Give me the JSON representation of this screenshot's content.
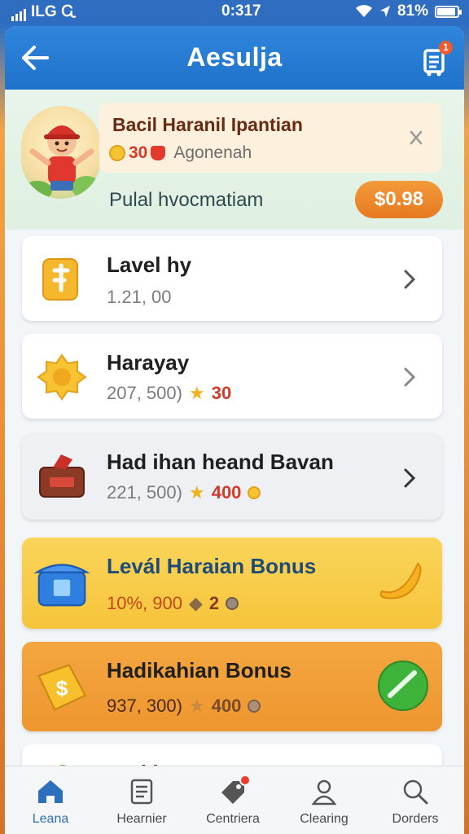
{
  "status_bar": {
    "carrier": "ILG",
    "time": "0:317",
    "battery": "81%"
  },
  "header": {
    "title": "Aesulja",
    "cart_badge": "1"
  },
  "hero": {
    "title": "Bacil Haranil Ipantian",
    "amount": "30",
    "subtitle": "Agonenah",
    "label": "Pulal hvocmatiam",
    "price": "$0.98"
  },
  "items": [
    {
      "title": "Lavel hy",
      "meta": "1.21, 00",
      "reward": "",
      "style": "white"
    },
    {
      "title": "Harayay",
      "meta": "207, 500)",
      "reward": "30",
      "style": "white"
    },
    {
      "title": "Had ihan heand Bavan",
      "meta": "221, 500)",
      "reward": "400",
      "style": "grey"
    },
    {
      "title": "Levál Haraian Bonus",
      "meta": "10%, 900",
      "reward": "2",
      "style": "yellow"
    },
    {
      "title": "Hadikahian Bonus",
      "meta": "937, 300)",
      "reward": "400",
      "style": "orange"
    },
    {
      "title": "Dati hammy",
      "meta": "",
      "reward": "",
      "style": "white"
    }
  ],
  "nav": [
    {
      "label": "Leana",
      "icon": "home-icon"
    },
    {
      "label": "Hearnier",
      "icon": "document-icon"
    },
    {
      "label": "Centriera",
      "icon": "tag-icon"
    },
    {
      "label": "Clearing",
      "icon": "user-icon"
    },
    {
      "label": "Dorders",
      "icon": "search-icon"
    }
  ],
  "colors": {
    "header_blue": "#2f86dc",
    "accent_orange": "#e6791f",
    "reward_red": "#d63a2a",
    "card_yellow": "#f8cf45",
    "card_orange": "#f2a23b"
  }
}
